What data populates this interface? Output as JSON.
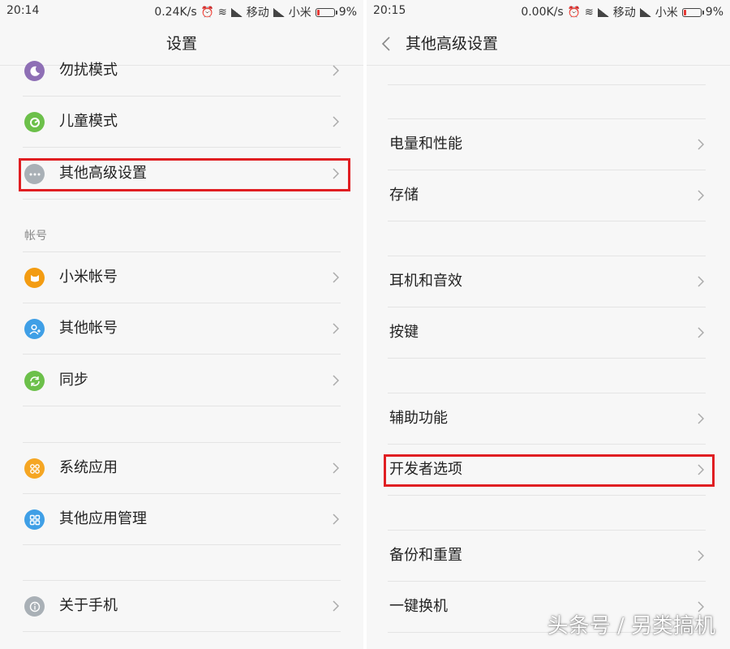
{
  "left": {
    "status": {
      "time": "20:14",
      "speed": "0.24K/s",
      "carrier1": "移动",
      "carrier2": "小米",
      "battery": "9%"
    },
    "title": "设置",
    "items": [
      {
        "label": "勿扰模式",
        "icon": "moon-icon",
        "color": "#8e6fb5"
      },
      {
        "label": "儿童模式",
        "icon": "child-mode-icon",
        "color": "#6cc04a"
      },
      {
        "label": "其他高级设置",
        "icon": "more-dots-icon",
        "color": "#a9b0b6"
      },
      {
        "label": "小米帐号",
        "icon": "mi-account-icon",
        "color": "#f39c12"
      },
      {
        "label": "其他帐号",
        "icon": "person-icon",
        "color": "#3f9fe6"
      },
      {
        "label": "同步",
        "icon": "sync-icon",
        "color": "#6cc04a"
      },
      {
        "label": "系统应用",
        "icon": "apps-icon",
        "color": "#f5a623"
      },
      {
        "label": "其他应用管理",
        "icon": "apps-grid-icon",
        "color": "#3f9fe6"
      },
      {
        "label": "关于手机",
        "icon": "info-icon",
        "color": "#a9b0b6"
      }
    ],
    "section_account": "帐号"
  },
  "right": {
    "status": {
      "time": "20:15",
      "speed": "0.00K/s",
      "carrier1": "移动",
      "carrier2": "小米",
      "battery": "9%"
    },
    "title": "其他高级设置",
    "items": [
      {
        "label": "电量和性能"
      },
      {
        "label": "存储"
      },
      {
        "label": "耳机和音效"
      },
      {
        "label": "按键"
      },
      {
        "label": "辅助功能"
      },
      {
        "label": "开发者选项"
      },
      {
        "label": "备份和重置"
      },
      {
        "label": "一键换机"
      }
    ]
  },
  "watermark": "头条号 / 另类搞机",
  "colors": {
    "highlight": "#e01e22",
    "background": "#f7f7f7"
  }
}
